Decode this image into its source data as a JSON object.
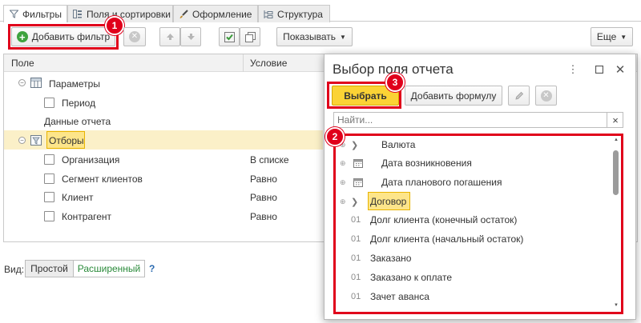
{
  "tabs": [
    {
      "label": "Фильтры",
      "icon": "filter-icon"
    },
    {
      "label": "Поля и сортировки",
      "icon": "fields-icon"
    },
    {
      "label": "Оформление",
      "icon": "brush-icon"
    },
    {
      "label": "Структура",
      "icon": "structure-icon"
    }
  ],
  "toolbar": {
    "add_filter": "Добавить фильтр",
    "show": "Показывать",
    "more": "Еще"
  },
  "grid": {
    "columns": [
      "Поле",
      "Условие"
    ],
    "rows": [
      {
        "label": "Параметры",
        "condition": ""
      },
      {
        "label": "Период",
        "condition": ""
      },
      {
        "label": "Данные отчета",
        "condition": ""
      },
      {
        "label": "Отборы",
        "condition": ""
      },
      {
        "label": "Организация",
        "condition": "В списке"
      },
      {
        "label": "Сегмент клиентов",
        "condition": "Равно"
      },
      {
        "label": "Клиент",
        "condition": "Равно"
      },
      {
        "label": "Контрагент",
        "condition": "Равно"
      }
    ]
  },
  "view": {
    "label": "Вид:",
    "simple": "Простой",
    "extended": "Расширенный",
    "help": "?"
  },
  "dialog": {
    "title": "Выбор поля отчета",
    "select": "Выбрать",
    "add_formula": "Добавить формулу",
    "search_placeholder": "Найти...",
    "clear": "×",
    "items": [
      {
        "prefix": "⊕",
        "icon": "chevron-right-icon",
        "label": "Валюта"
      },
      {
        "prefix": "⊕",
        "icon": "calendar-icon",
        "label": "Дата возникновения"
      },
      {
        "prefix": "⊕",
        "icon": "calendar-icon",
        "label": "Дата планового погашения"
      },
      {
        "prefix": "⊕",
        "icon": "chevron-right-icon",
        "label": "Договор"
      },
      {
        "prefix": "",
        "icon": "01",
        "label": "Долг клиента (конечный остаток)"
      },
      {
        "prefix": "",
        "icon": "01",
        "label": "Долг клиента (начальный остаток)"
      },
      {
        "prefix": "",
        "icon": "01",
        "label": "Заказано"
      },
      {
        "prefix": "",
        "icon": "01",
        "label": "Заказано к оплате"
      },
      {
        "prefix": "",
        "icon": "01",
        "label": "Зачет аванса"
      }
    ]
  },
  "badges": [
    "1",
    "2",
    "3"
  ],
  "colors": {
    "highlight_red": "#e0001b",
    "highlight_yellow": "#fde58a",
    "selected_row": "#fbf0c8"
  }
}
